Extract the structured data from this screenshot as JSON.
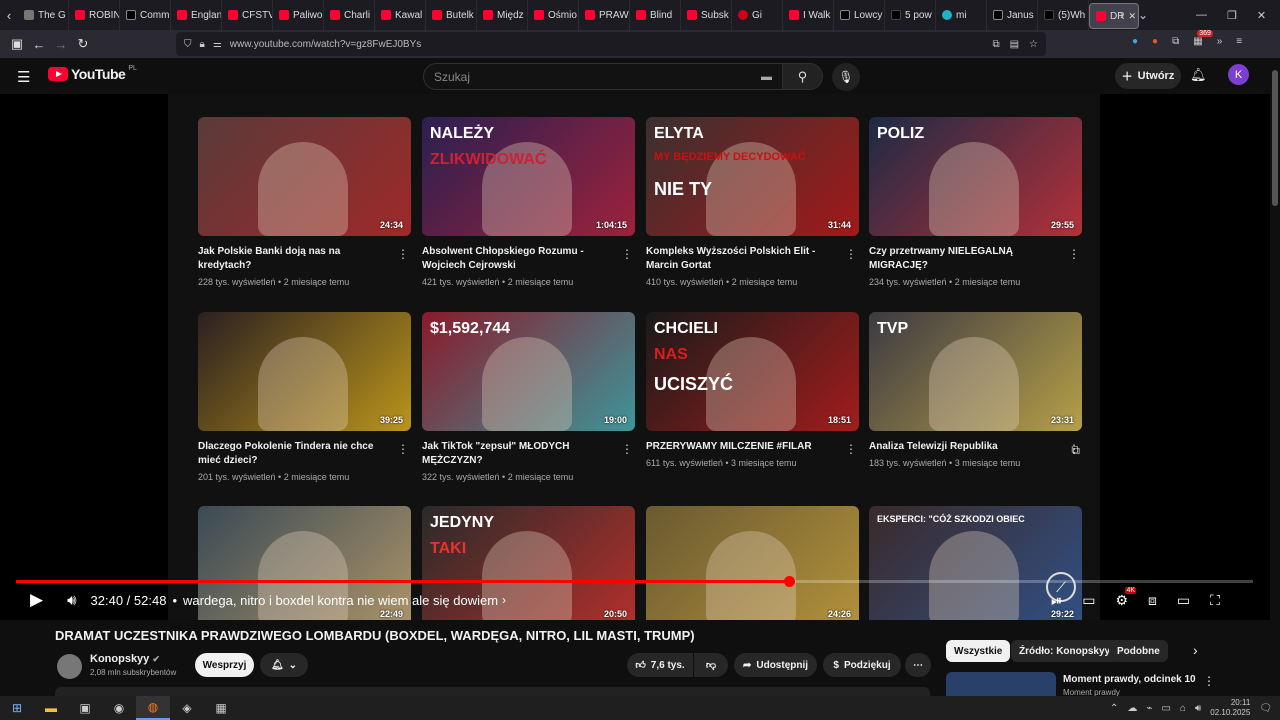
{
  "browser": {
    "tabs": [
      {
        "label": "The G",
        "fav": "grey"
      },
      {
        "label": "ROBIN",
        "fav": "yt"
      },
      {
        "label": "Comm",
        "fav": "x"
      },
      {
        "label": "Englan",
        "fav": "yt"
      },
      {
        "label": "CFSTV",
        "fav": "yt"
      },
      {
        "label": "Paliwo",
        "fav": "yt"
      },
      {
        "label": "Charli",
        "fav": "yt"
      },
      {
        "label": "Kawal",
        "fav": "yt"
      },
      {
        "label": "Butelk",
        "fav": "yt"
      },
      {
        "label": "Międz",
        "fav": "yt"
      },
      {
        "label": "Ośmio",
        "fav": "yt"
      },
      {
        "label": "PRAW",
        "fav": "yt"
      },
      {
        "label": "Blind",
        "fav": "yt"
      },
      {
        "label": "Subsk",
        "fav": "yt"
      },
      {
        "label": "Gi",
        "fav": "red"
      },
      {
        "label": "I Walk",
        "fav": "yt"
      },
      {
        "label": "Lowcy",
        "fav": "x"
      },
      {
        "label": "5 pow",
        "fav": "tt"
      },
      {
        "label": "mi",
        "fav": "teal"
      },
      {
        "label": "Janus",
        "fav": "x"
      },
      {
        "label": "(5)Wh",
        "fav": "tt"
      },
      {
        "label": "DR",
        "fav": "yt",
        "active": true
      }
    ],
    "url": "www.youtube.com/watch?v=gz8FwEJ0BYs",
    "ext_badge": "369"
  },
  "youtube": {
    "logo": "YouTube",
    "region": "PL",
    "search_placeholder": "Szukaj",
    "create_label": "Utwórz",
    "avatar_letter": "K"
  },
  "endscreen": {
    "videos": [
      {
        "title": "Jak Polskie Banki doją nas na kredytach?",
        "views": "228 tys. wyświetleń",
        "age": "2 miesiące temu",
        "duration": "24:34",
        "color": "#5a3a3a",
        "accent": "#b22"
      },
      {
        "title": "Absolwent Chłopskiego Rozumu - Wojciech Cejrowski",
        "views": "421 tys. wyświetleń",
        "age": "2 miesiące temu",
        "duration": "1:04:15",
        "color": "#2a2050",
        "accent": "#c23",
        "overlay": "NALEŻY",
        "overlay2": "ZLIKWIDOWAĆ"
      },
      {
        "title": "Kompleks Wyższości Polskich Elit - Marcin Gortat",
        "views": "410 tys. wyświetleń",
        "age": "2 miesiące temu",
        "duration": "31:44",
        "color": "#3a3030",
        "accent": "#cc1010",
        "overlay": "ELYTA",
        "overlay2": "MY BĘDZIEMY DECYDOWAĆ",
        "overlay3": "NIE TY"
      },
      {
        "title": "Czy przetrwamy NIELEGALNĄ MIGRACJĘ?",
        "views": "234 tys. wyświetleń",
        "age": "2 miesiące temu",
        "duration": "29:55",
        "color": "#1d2a45",
        "accent": "#e33",
        "overlay": "POLIZ"
      },
      {
        "title": "Dlaczego Pokolenie Tindera nie chce mieć dzieci?",
        "views": "201 tys. wyświetleń",
        "age": "2 miesiące temu",
        "duration": "39:25",
        "color": "#2b2020",
        "accent": "#f4c31a"
      },
      {
        "title": "Jak TikTok \"zepsuł\" MŁODYCH MĘŻCZYZN?",
        "views": "322 tys. wyświetleń",
        "age": "2 miesiące temu",
        "duration": "19:00",
        "color": "#8a1a2a",
        "accent": "#1fc7c7",
        "overlay": "$1,592,744"
      },
      {
        "title": "PRZERYWAMY MILCZENIE #FILAR",
        "views": "611 tys. wyświetleń",
        "age": "3 miesiące temu",
        "duration": "18:51",
        "color": "#1a1a1a",
        "accent": "#d91e1e",
        "overlay": "CHCIELI",
        "overlay2": "NAS",
        "overlay3": "UCISZYĆ"
      },
      {
        "title": "Analiza Telewizji Republika",
        "views": "183 tys. wyświetleń",
        "age": "3 miesiące temu",
        "duration": "23:31",
        "color": "#3c3a42",
        "accent": "#e6c84a",
        "overlay": "TVP"
      },
      {
        "title": "",
        "views": "",
        "age": "",
        "duration": "22:49",
        "color": "#3a4a55",
        "accent": "#d8b070"
      },
      {
        "title": "",
        "views": "",
        "age": "",
        "duration": "20:50",
        "color": "#2a2a2a",
        "accent": "#e8322c",
        "overlay": "JEDYNY",
        "overlay2": "TAKI"
      },
      {
        "title": "",
        "views": "",
        "age": "",
        "duration": "24:26",
        "color": "#6a5a30",
        "accent": "#cfa740"
      },
      {
        "title": "",
        "views": "",
        "age": "",
        "duration": "29:22",
        "color": "#3a2a2a",
        "accent": "#2d5fa8",
        "overlay": "EKSPERCI: \"CÓŻ SZKODZI OBIEC"
      }
    ]
  },
  "player": {
    "time": "32:40 / 52:48",
    "chapter": "wardega, nitro i boxdel kontra nie wiem ale się dowiem",
    "progress": 0.625,
    "badge_4k": "4K"
  },
  "video": {
    "title": "DRAMAT UCZESTNIKA PRAWDZIWEGO LOMBARDU (BOXDEL, WARDĘGA, NITRO, LIL MASTI, TRUMP)",
    "channel": "Konopskyy",
    "subscribers": "2,08 mln subskrybentów",
    "support_label": "Wesprzyj",
    "likes": "7,6 tys.",
    "share_label": "Udostępnij",
    "thanks_label": "Podziękuj"
  },
  "chips": [
    "Wszystkie",
    "Źródło: Konopskyy",
    "Podobne"
  ],
  "side_video": {
    "title": "Moment prawdy, odcinek 10",
    "channel": "Moment prawdy"
  },
  "clock": {
    "time": "20:11",
    "date": "02.10.2025"
  }
}
